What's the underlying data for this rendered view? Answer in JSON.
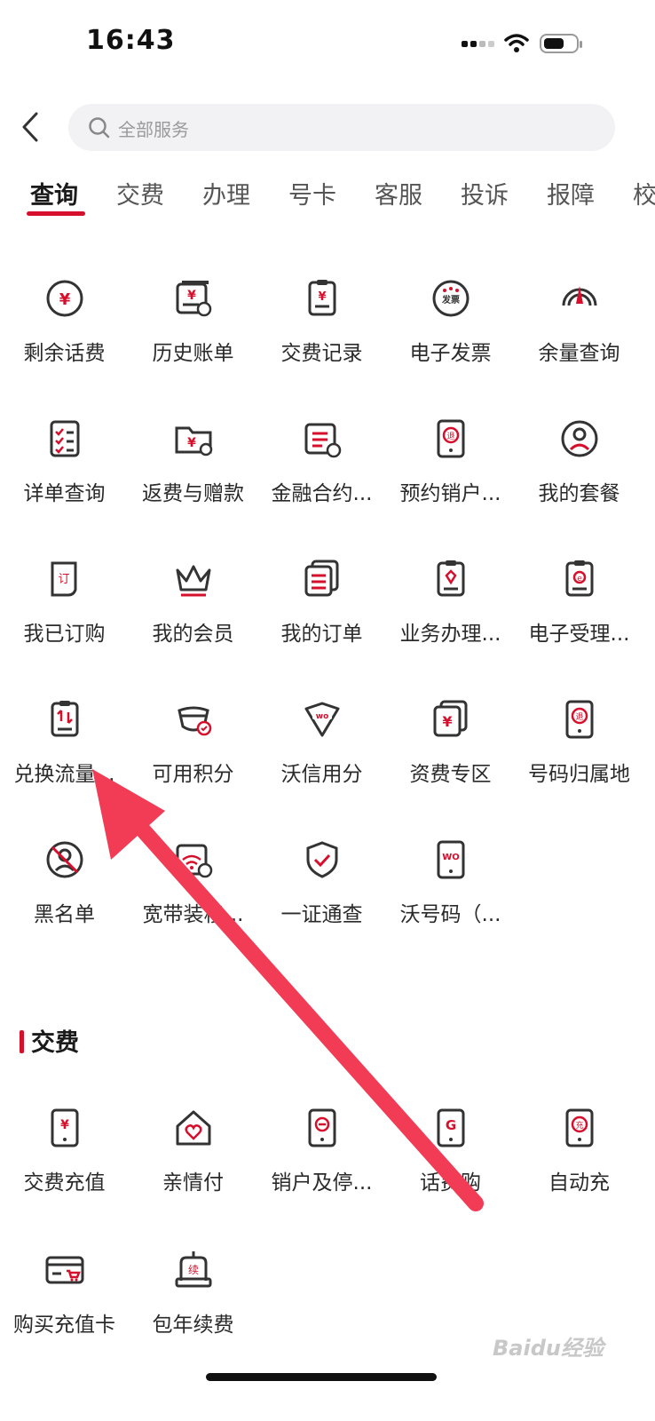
{
  "status_bar": {
    "time": "16:43"
  },
  "search": {
    "placeholder": "全部服务"
  },
  "tabs": [
    "查询",
    "交费",
    "办理",
    "号卡",
    "客服",
    "投诉",
    "报障",
    "校"
  ],
  "query_items": [
    {
      "label": "剩余话费",
      "icon": "yuan-circle-icon"
    },
    {
      "label": "历史账单",
      "icon": "bill-history-icon"
    },
    {
      "label": "交费记录",
      "icon": "clipboard-icon"
    },
    {
      "label": "电子发票",
      "icon": "invoice-icon"
    },
    {
      "label": "余量查询",
      "icon": "gauge-icon"
    },
    {
      "label": "详单查询",
      "icon": "checklist-icon"
    },
    {
      "label": "返费与赠款",
      "icon": "refund-folder-icon"
    },
    {
      "label": "金融合约...",
      "icon": "contract-icon"
    },
    {
      "label": "预约销户...",
      "icon": "phone-cancel-icon"
    },
    {
      "label": "我的套餐",
      "icon": "user-circle-icon"
    },
    {
      "label": "我已订购",
      "icon": "order-doc-icon"
    },
    {
      "label": "我的会员",
      "icon": "crown-icon"
    },
    {
      "label": "我的订单",
      "icon": "orders-icon"
    },
    {
      "label": "业务办理...",
      "icon": "service-clipboard-icon"
    },
    {
      "label": "电子受理...",
      "icon": "e-clipboard-icon"
    },
    {
      "label": "兑换流量...",
      "icon": "exchange-data-icon"
    },
    {
      "label": "可用积分",
      "icon": "points-icon"
    },
    {
      "label": "沃信用分",
      "icon": "wo-credit-icon"
    },
    {
      "label": "资费专区",
      "icon": "tariff-icon"
    },
    {
      "label": "号码归属地",
      "icon": "phone-location-icon"
    },
    {
      "label": "黑名单",
      "icon": "blacklist-icon"
    },
    {
      "label": "宽带装移...",
      "icon": "broadband-icon"
    },
    {
      "label": "一证通查",
      "icon": "shield-check-icon"
    },
    {
      "label": "沃号码（...",
      "icon": "wo-phone-icon"
    }
  ],
  "pay_section": {
    "title": "交费",
    "items": [
      {
        "label": "交费充值",
        "icon": "phone-yuan-icon"
      },
      {
        "label": "亲情付",
        "icon": "family-heart-icon"
      },
      {
        "label": "销户及停...",
        "icon": "phone-stop-icon"
      },
      {
        "label": "话费购",
        "icon": "phone-g-icon"
      },
      {
        "label": "自动充",
        "icon": "phone-auto-icon"
      },
      {
        "label": "购买充值卡",
        "icon": "card-cart-icon"
      },
      {
        "label": "包年续费",
        "icon": "renew-icon"
      }
    ]
  },
  "watermark": "Baidu经验",
  "colors": {
    "accent": "#d6102c",
    "text": "#2a2a2a",
    "search_bg": "#f2f2f4",
    "arrow": "#f23c55"
  }
}
